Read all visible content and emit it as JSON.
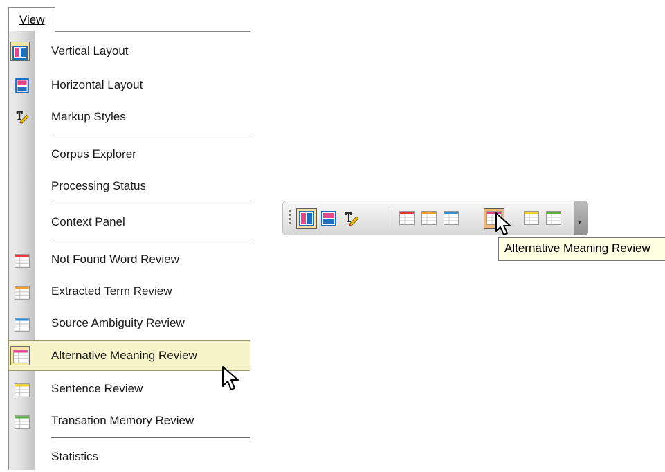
{
  "menu": {
    "title": "View",
    "items": [
      {
        "label": "Vertical Layout",
        "icon": "vertical-layout-icon"
      },
      {
        "label": "Horizontal Layout",
        "icon": "horizontal-layout-icon"
      },
      {
        "label": "Markup Styles",
        "icon": "markup-styles-icon"
      },
      {
        "label": "Corpus Explorer",
        "icon": ""
      },
      {
        "label": "Processing Status",
        "icon": ""
      },
      {
        "label": "Context Panel",
        "icon": ""
      },
      {
        "label": "Not Found Word Review",
        "icon": "table-red-icon"
      },
      {
        "label": "Extracted Term Review",
        "icon": "table-orange-icon"
      },
      {
        "label": "Source Ambiguity Review",
        "icon": "table-blue-icon"
      },
      {
        "label": "Alternative Meaning Review",
        "icon": "table-pink-icon"
      },
      {
        "label": "Sentence Review",
        "icon": "table-yellow-icon"
      },
      {
        "label": "Transation Memory Review",
        "icon": "table-green-icon"
      },
      {
        "label": "Statistics",
        "icon": ""
      }
    ],
    "highlighted": "Alternative Meaning Review",
    "checked": "Vertical Layout"
  },
  "toolbar": {
    "buttons": [
      "vertical-layout-icon",
      "horizontal-layout-icon",
      "markup-styles-icon",
      "table-red-icon",
      "table-orange-icon",
      "table-blue-icon",
      "table-pink-icon",
      "table-yellow-icon",
      "table-green-icon"
    ],
    "tooltip": "Alternative Meaning Review"
  },
  "colors": {
    "red": "#e23a3a",
    "orange": "#f0a030",
    "blue": "#3a8fd0",
    "pink": "#e0418f",
    "yellow": "#f0cf30",
    "green": "#58b040",
    "layout_blue": "#1f6fc0",
    "layout_pink": "#e04a8a",
    "highlight": "#f6f4c8"
  }
}
